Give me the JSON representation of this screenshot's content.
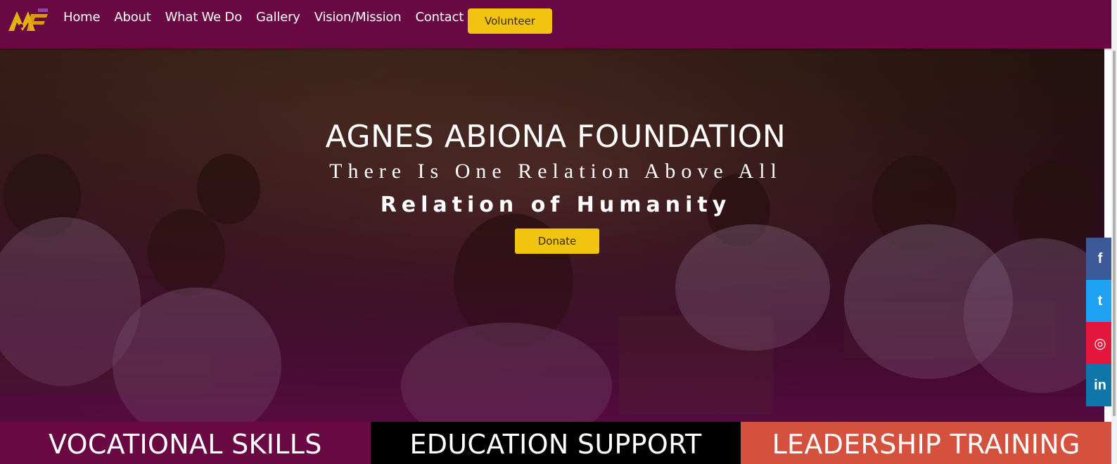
{
  "nav": {
    "links": [
      "Home",
      "About",
      "What We Do",
      "Gallery",
      "Vision/Mission",
      "Contact Us"
    ],
    "volunteer_label": "Volunteer"
  },
  "hero": {
    "title": "AGNES ABIONA FOUNDATION",
    "subtitle1": "There Is One Relation Above All",
    "subtitle2": "Relation of Humanity",
    "donate_label": "Donate"
  },
  "social": [
    {
      "name": "facebook-icon",
      "glyph": "f"
    },
    {
      "name": "twitter-icon",
      "glyph": "t"
    },
    {
      "name": "instagram-icon",
      "glyph": "◎"
    },
    {
      "name": "linkedin-icon",
      "glyph": "in"
    }
  ],
  "cards": [
    "VOCATIONAL SKILLS",
    "EDUCATION SUPPORT",
    "LEADERSHIP TRAINING"
  ],
  "colors": {
    "brand": "#6a0844",
    "accent": "#f1c40f",
    "card_black": "#000000",
    "card_orange": "#d4523d"
  }
}
